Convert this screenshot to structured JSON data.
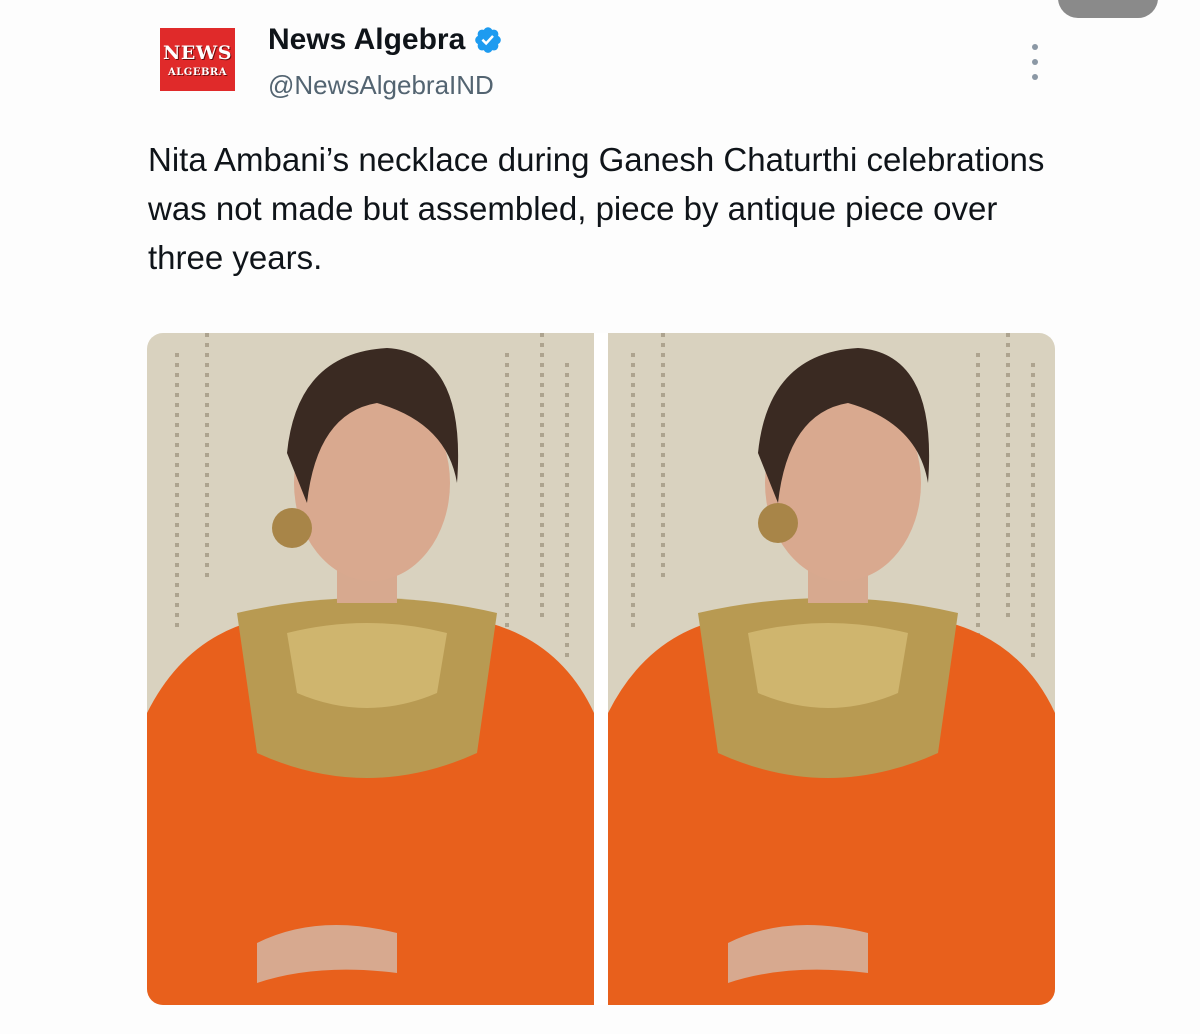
{
  "account": {
    "display_name": "News Algebra",
    "handle": "@NewsAlgebraIND",
    "verified": true,
    "logo_line1": "NEWS",
    "logo_line2": "ALGEBRA"
  },
  "tweet": {
    "text": "Nita Ambani’s necklace during Ganesh Chaturthi celebrations was not made but assembled, piece by antique piece over three years."
  },
  "media": {
    "count": 2,
    "description_icons": [
      "photo-left",
      "photo-right"
    ]
  },
  "icons": {
    "verified": "verified-badge-icon",
    "more": "more-options-icon"
  },
  "colors": {
    "logo_bg": "#e02a2a",
    "verified_blue": "#1d9bf0",
    "handle_gray": "#536471",
    "saree_orange": "#e8601c",
    "necklace_gold": "#b89a52",
    "backdrop_cream": "#d9d2bf"
  }
}
